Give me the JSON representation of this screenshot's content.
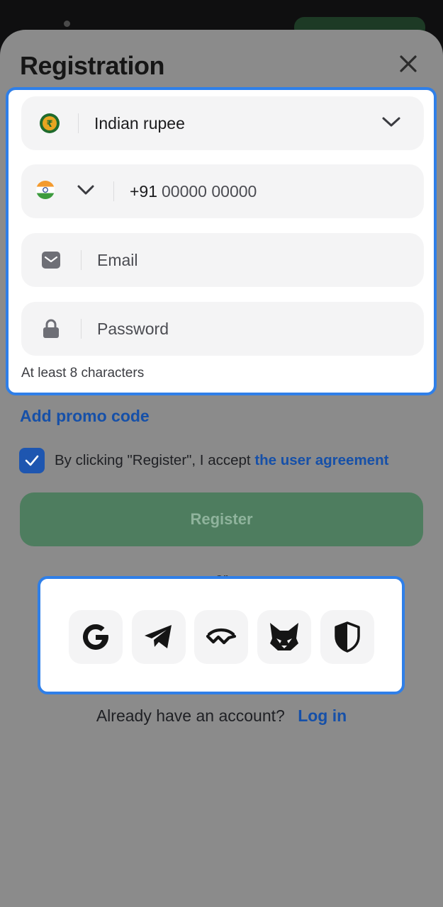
{
  "header": {
    "title": "Registration",
    "close_icon": "close-icon"
  },
  "currency": {
    "icon": "rupee-coin-icon",
    "value": "Indian rupee",
    "dropdown_icon": "chevron-down-icon"
  },
  "phone": {
    "flag_icon": "india-flag-icon",
    "dropdown_icon": "chevron-down-icon",
    "code": "+91",
    "placeholder": "00000 00000"
  },
  "email": {
    "icon": "mail-icon",
    "placeholder": "Email"
  },
  "password": {
    "icon": "lock-icon",
    "placeholder": "Password",
    "hint": "At least 8 characters"
  },
  "promo": {
    "label": "Add promo code"
  },
  "agreement": {
    "checked": true,
    "text": "By clicking \"Register\", I accept",
    "link": "the user agreement"
  },
  "register": {
    "label": "Register"
  },
  "divider": {
    "label": "or"
  },
  "social": [
    {
      "name": "google-icon"
    },
    {
      "name": "telegram-icon"
    },
    {
      "name": "walletconnect-icon"
    },
    {
      "name": "metamask-fox-icon"
    },
    {
      "name": "shield-icon"
    }
  ],
  "login": {
    "text": "Already have an account?",
    "link": "Log in"
  },
  "colors": {
    "accent": "#2f7fe8",
    "link": "#1650a8",
    "register_bg": "#4e7d5f",
    "overlay": "#8b8b8b"
  }
}
